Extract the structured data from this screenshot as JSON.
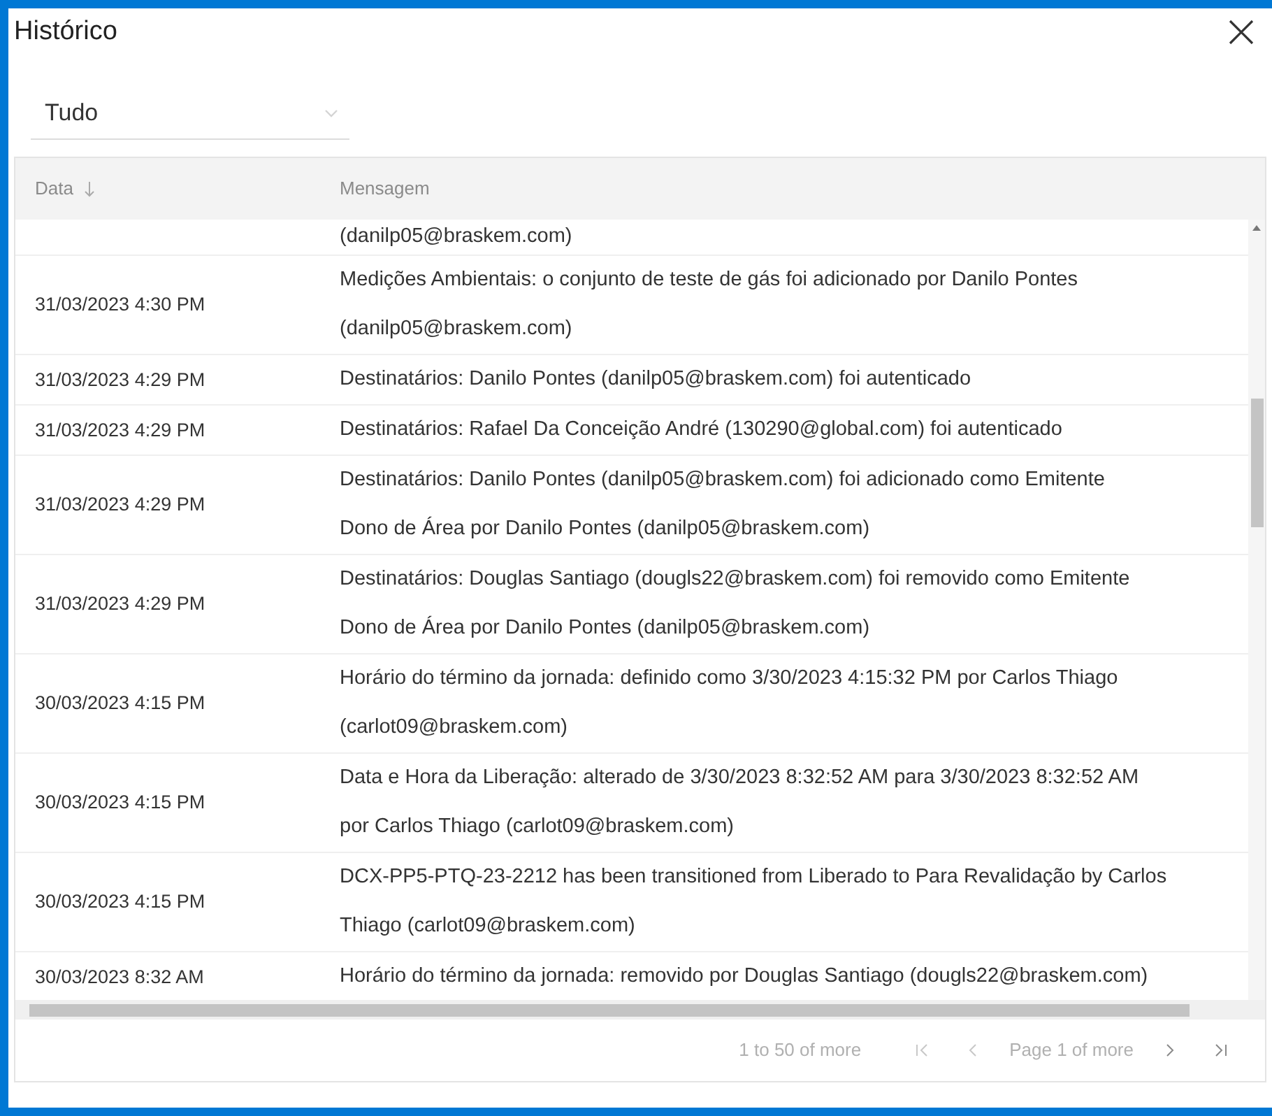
{
  "dialog": {
    "title": "Histórico"
  },
  "filter": {
    "value": "Tudo"
  },
  "table": {
    "columns": [
      {
        "label": "Data",
        "sorted": true
      },
      {
        "label": "Mensagem",
        "sorted": false
      }
    ],
    "rows": [
      {
        "date": "",
        "message": "(danilp05@braskem.com)"
      },
      {
        "date": "31/03/2023 4:30 PM",
        "message": "Medições Ambientais: o conjunto de teste de gás foi adicionado por Danilo Pontes\n(danilp05@braskem.com)"
      },
      {
        "date": "31/03/2023 4:29 PM",
        "message": "Destinatários: Danilo Pontes (danilp05@braskem.com) foi autenticado"
      },
      {
        "date": "31/03/2023 4:29 PM",
        "message": "Destinatários: Rafael Da Conceição André (130290@global.com) foi autenticado"
      },
      {
        "date": "31/03/2023 4:29 PM",
        "message": "Destinatários: Danilo Pontes (danilp05@braskem.com) foi adicionado como Emitente\nDono de Área por Danilo Pontes (danilp05@braskem.com)"
      },
      {
        "date": "31/03/2023 4:29 PM",
        "message": "Destinatários: Douglas Santiago (dougls22@braskem.com) foi removido como Emitente\nDono de Área por Danilo Pontes (danilp05@braskem.com)"
      },
      {
        "date": "30/03/2023 4:15 PM",
        "message": "Horário do término da jornada: definido como 3/30/2023 4:15:32 PM por Carlos Thiago\n(carlot09@braskem.com)"
      },
      {
        "date": "30/03/2023 4:15 PM",
        "message": "Data e Hora da Liberação: alterado de 3/30/2023 8:32:52 AM para 3/30/2023 8:32:52 AM\npor Carlos Thiago (carlot09@braskem.com)"
      },
      {
        "date": "30/03/2023 4:15 PM",
        "message": "DCX-PP5-PTQ-23-2212 has been transitioned from Liberado to Para Revalidação by Carlos\nThiago (carlot09@braskem.com)"
      },
      {
        "date": "30/03/2023 8:32 AM",
        "message": "Horário do término da jornada: removido por Douglas Santiago (dougls22@braskem.com)"
      }
    ]
  },
  "pager": {
    "summary": "1 to 50 of more",
    "page": "Page 1 of more",
    "first_disabled": true,
    "prev_disabled": true,
    "next_disabled": false,
    "last_disabled": false
  }
}
